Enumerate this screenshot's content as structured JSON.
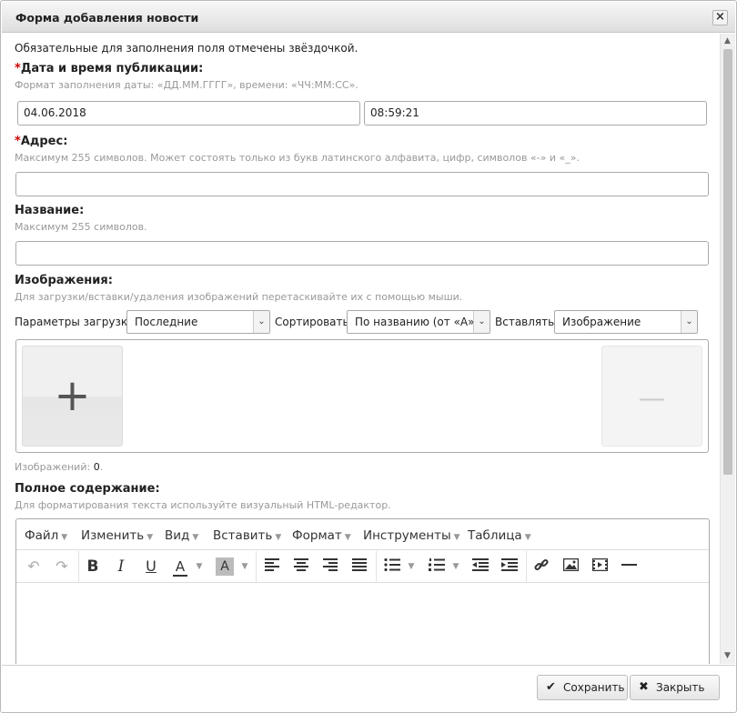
{
  "dialog": {
    "title": "Форма добавления новости",
    "close_label": "×"
  },
  "form": {
    "required_note": "Обязательные для заполнения поля отмечены звёздочкой.",
    "required_mark": "*",
    "datetime": {
      "label": "Дата и время публикации:",
      "hint": "Формат заполнения даты: «ДД.ММ.ГГГГ», времени: «ЧЧ:ММ:СС».",
      "date_value": "04.06.2018",
      "time_value": "08:59:21"
    },
    "address": {
      "label": "Адрес:",
      "hint": "Максимум 255 символов. Может состоять только из букв латинского алфавита, цифр, символов «-» и «_».",
      "value": ""
    },
    "name": {
      "label": "Название:",
      "hint": "Максимум 255 символов.",
      "value": ""
    },
    "images": {
      "label": "Изображения:",
      "hint": "Для загрузки/вставки/удаления изображений перетаскивайте их с помощью мыши.",
      "upload_params_label": "Параметры загрузки:",
      "upload_params_value": "Последние",
      "sort_label": "Сортировать:",
      "sort_value": "По названию (от «А» к",
      "insert_label": "Вставлять:",
      "insert_value": "Изображение",
      "add_glyph": "+",
      "remove_glyph": "—",
      "count_label": "Изображений:",
      "count_value": "0",
      "count_suffix": "."
    },
    "content": {
      "label": "Полное содержание:",
      "hint": "Для форматирования текста используйте визуальный HTML-редактор."
    }
  },
  "editor": {
    "menu": [
      "Файл",
      "Изменить",
      "Вид",
      "Вставить",
      "Формат",
      "Инструменты",
      "Таблица"
    ],
    "icons": {
      "undo": "↶",
      "redo": "↷",
      "bold": "B",
      "italic": "I",
      "underline": "U",
      "text_color": "A",
      "bg_color": "A"
    },
    "accent_colors": {
      "text_color_bar": "#333333",
      "bg_color_box": "#bbbbbb"
    }
  },
  "footer": {
    "save_label": "Сохранить",
    "close_label": "Закрыть",
    "save_icon": "✔",
    "close_icon": "✖"
  }
}
